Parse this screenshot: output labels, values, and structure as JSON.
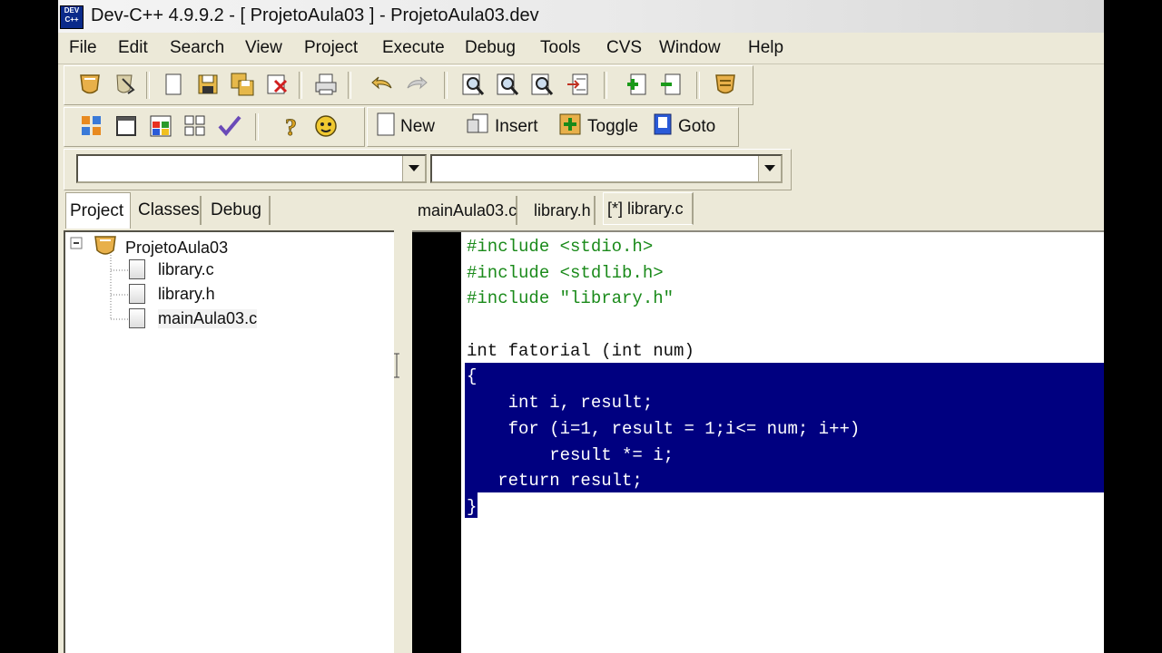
{
  "window": {
    "title": "Dev-C++ 4.9.9.2  -  [ ProjetoAula03 ] - ProjetoAula03.dev",
    "logo_text": "DEV C++"
  },
  "menu": [
    "File",
    "Edit",
    "Search",
    "View",
    "Project",
    "Execute",
    "Debug",
    "Tools",
    "CVS",
    "Window",
    "Help"
  ],
  "toolbar2": {
    "new_label": "New",
    "insert_label": "Insert",
    "toggle_label": "Toggle",
    "goto_label": "Goto"
  },
  "combos": [
    {
      "value": ""
    },
    {
      "value": ""
    }
  ],
  "left_panel": {
    "tabs": [
      "Project",
      "Classes",
      "Debug"
    ],
    "active_tab": "Project",
    "tree": {
      "project": "ProjetoAula03",
      "files": [
        "library.c",
        "library.h",
        "mainAula03.c"
      ]
    }
  },
  "editor": {
    "tabs": [
      "mainAula03.c",
      "library.h",
      "[*] library.c"
    ],
    "active_tab": "[*] library.c",
    "lines": [
      "#include <stdio.h>",
      "#include <stdlib.h>",
      "#include \"library.h\"",
      "",
      "int fatorial (int num)",
      "{",
      "    int i, result;",
      "    for (i=1, result = 1;i<= num; i++)",
      "        result *= i;",
      "   return result;",
      "}"
    ]
  },
  "colors": {
    "selection": "#000080",
    "include_text": "#1a8a1a",
    "window_bg": "#ece9d8"
  }
}
